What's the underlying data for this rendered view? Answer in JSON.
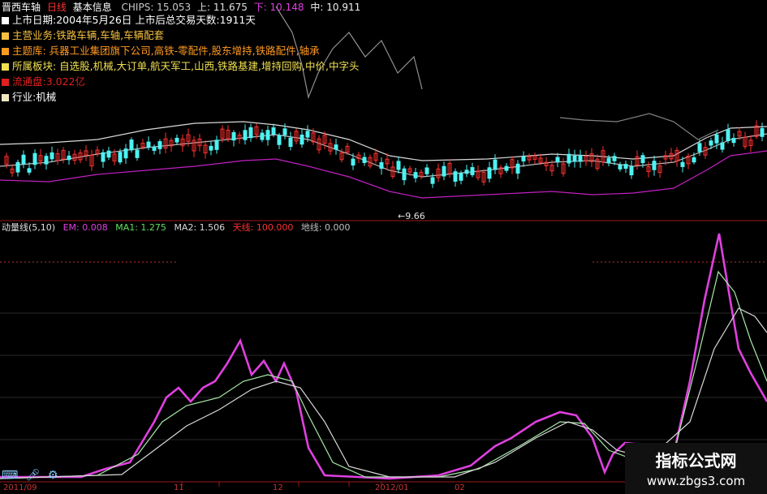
{
  "header": {
    "stock_name": "晋西车轴",
    "period": "日线",
    "info_tab": "基本信息",
    "chips_label": "CHIPS: 15.053",
    "upper_label": "上: 11.675",
    "lower_label": "下: 10.148",
    "mid_label": "中: 10.911"
  },
  "info": {
    "list_date": "上市日期:2004年5月26日  上市后总交易天数:1911天",
    "main_business": "主营业务:铁路车辆,车轴,车辆配套",
    "theme": "主题库: 兵器工业集团旗下公司,高铁-零配件,股东增持,铁路配件,轴承",
    "sectors": "所属板块:  自选股,机械,大订单,航天军工,山西,铁路基建,增持回购,中价,中字头",
    "float_cap": "流通盘:3.022亿",
    "industry": "行业:机械"
  },
  "price_annotation": "9.66",
  "indicator": {
    "name": "动量线(5,10)",
    "em": "EM: 0.008",
    "ma1": "MA1: 1.275",
    "ma2": "MA2: 1.506",
    "strength": "天线: 100.000",
    "extra": "地线: 0.000"
  },
  "date_axis": [
    "2011/09",
    "11",
    "12",
    "2012/01",
    "02"
  ],
  "watermark": {
    "title": "指标公式网",
    "url": "www.zbgs3.com"
  },
  "icons": [
    "keyboard-icon",
    "mic-icon",
    "gear-icon"
  ],
  "colors": {
    "up": "#ff3030",
    "down": "#4ef2f2",
    "band_upper": "#d9d9d9",
    "band_mid": "#cfcfcf",
    "band_lower": "#c020c0",
    "em": "#e040e0",
    "ma1": "#a8e8a8",
    "ma2": "#d8d8d8",
    "axis": "#a01818"
  }
}
